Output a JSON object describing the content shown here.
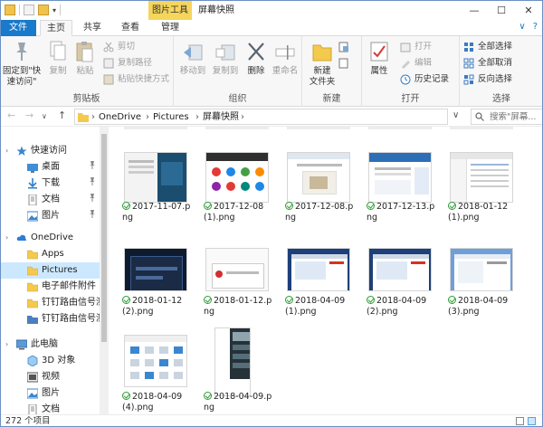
{
  "window": {
    "title": "屏幕快照",
    "context_tab": "图片工具",
    "controls": {
      "minimize": "—",
      "maximize": "☐",
      "close": "✕"
    }
  },
  "quick_access": {
    "dropdown": "▾"
  },
  "ribbon_tabs": [
    "文件",
    "主页",
    "共享",
    "查看",
    "管理"
  ],
  "ribbon_help": {
    "collapse": "∨",
    "help": "?"
  },
  "ribbon": {
    "clipboard": {
      "label": "剪贴板",
      "pin": "固定到\"快\n速访问\"",
      "copy": "复制",
      "paste": "粘贴",
      "cut": "剪切",
      "copy_path": "复制路径",
      "paste_shortcut": "粘贴快捷方式"
    },
    "organize": {
      "label": "组织",
      "move_to": "移动到",
      "copy_to": "复制到",
      "delete": "删除",
      "rename": "重命名"
    },
    "new": {
      "label": "新建",
      "new_folder": "新建\n文件夹"
    },
    "open": {
      "label": "打开",
      "properties": "属性",
      "open": "打开",
      "edit": "编辑",
      "history": "历史记录"
    },
    "select": {
      "label": "选择",
      "select_all": "全部选择",
      "select_none": "全部取消",
      "invert": "反向选择"
    }
  },
  "address": {
    "back": "←",
    "forward": "→",
    "recent": "∨",
    "up": "↑",
    "crumbs": [
      "OneDrive",
      "Pictures",
      "屏幕快照"
    ],
    "separator": "›",
    "refresh": "↻",
    "search_placeholder": "搜索\"屏幕..."
  },
  "nav_pane": [
    {
      "label": "快速访问",
      "icon": "star-icon",
      "pinned": false
    },
    {
      "label": "桌面",
      "icon": "desktop-folder-icon",
      "pinned": true
    },
    {
      "label": "下载",
      "icon": "download-folder-icon",
      "pinned": true
    },
    {
      "label": "文档",
      "icon": "documents-folder-icon",
      "pinned": true
    },
    {
      "label": "图片",
      "icon": "pictures-folder-icon",
      "pinned": true
    },
    {
      "label": "OneDrive",
      "icon": "cloud-icon",
      "pinned": false
    },
    {
      "label": "Apps",
      "icon": "folder-icon",
      "pinned": false
    },
    {
      "label": "Pictures",
      "icon": "folder-icon",
      "pinned": false,
      "selected": true
    },
    {
      "label": "电子邮件附件",
      "icon": "folder-icon",
      "pinned": false
    },
    {
      "label": "钉钉路由信号测试",
      "icon": "folder-icon",
      "pinned": false
    },
    {
      "label": "钉钉路由信号测试",
      "icon": "folder-blue-icon",
      "pinned": false
    },
    {
      "label": "此电脑",
      "icon": "computer-icon",
      "pinned": false
    },
    {
      "label": "3D 对象",
      "icon": "3d-objects-icon",
      "pinned": false
    },
    {
      "label": "视频",
      "icon": "videos-icon",
      "pinned": false
    },
    {
      "label": "图片",
      "icon": "pictures-folder-icon",
      "pinned": false
    },
    {
      "label": "文档",
      "icon": "documents-folder-icon",
      "pinned": false
    }
  ],
  "pin_glyph": "📌",
  "files": [
    {
      "name": "2017-11-07.png",
      "style": "split-dark"
    },
    {
      "name": "2017-12-08 (1).png",
      "style": "apps-grid"
    },
    {
      "name": "2017-12-08.png",
      "style": "webpage"
    },
    {
      "name": "2017-12-13.png",
      "style": "blue-article"
    },
    {
      "name": "2018-01-12 (1).png",
      "style": "list-window"
    },
    {
      "name": "2018-01-12 (2).png",
      "style": "dark-dialog"
    },
    {
      "name": "2018-01-12.png",
      "style": "small-dialog"
    },
    {
      "name": "2018-04-09 (1).png",
      "style": "desktop-browser"
    },
    {
      "name": "2018-04-09 (2).png",
      "style": "desktop-browser"
    },
    {
      "name": "2018-04-09 (3).png",
      "style": "light-browser"
    },
    {
      "name": "2018-04-09 (4).png",
      "style": "settings-grid"
    },
    {
      "name": "2018-04-09.png",
      "style": "phone-screen"
    }
  ],
  "status": {
    "item_count": "272 个项目"
  },
  "colors": {
    "accent": "#1979ca",
    "context_tab": "#f5d55b",
    "selection": "#cce8ff"
  }
}
